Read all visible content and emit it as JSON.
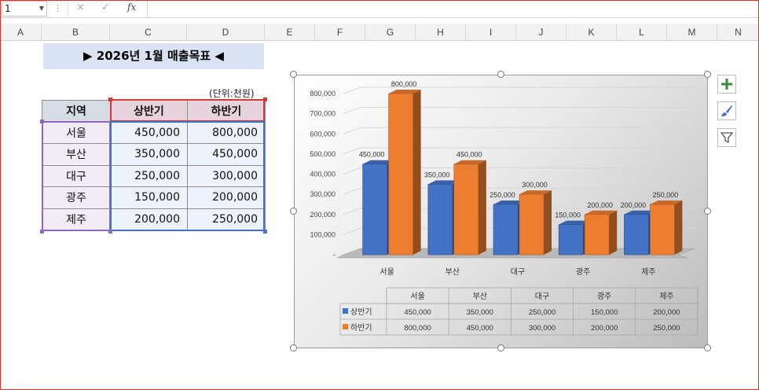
{
  "formula_bar": {
    "name_box": "1",
    "cancel_glyph": "×",
    "enter_glyph": "✓",
    "fx_label": "fx",
    "formula": ""
  },
  "columns": [
    "A",
    "B",
    "C",
    "D",
    "E",
    "F",
    "G",
    "H",
    "I",
    "J",
    "K",
    "L",
    "M",
    "N"
  ],
  "sheet": {
    "title": "▶ 2026년 1월 매출목표 ◀",
    "unit_note": "(단위:천원)",
    "headers": [
      "지역",
      "상반기",
      "하반기"
    ],
    "rows": [
      {
        "region": "서울",
        "h1": "450,000",
        "h2": "800,000"
      },
      {
        "region": "부산",
        "h1": "350,000",
        "h2": "450,000"
      },
      {
        "region": "대구",
        "h1": "250,000",
        "h2": "300,000"
      },
      {
        "region": "광주",
        "h1": "150,000",
        "h2": "200,000"
      },
      {
        "region": "제주",
        "h1": "200,000",
        "h2": "250,000"
      }
    ]
  },
  "chart_data": {
    "type": "bar",
    "style": "3d-clustered-column",
    "categories": [
      "서울",
      "부산",
      "대구",
      "광주",
      "제주"
    ],
    "series": [
      {
        "name": "상반기",
        "color": "#4472c4",
        "values": [
          450000,
          350000,
          250000,
          150000,
          200000
        ]
      },
      {
        "name": "하반기",
        "color": "#ed7d31",
        "values": [
          800000,
          450000,
          300000,
          200000,
          250000
        ]
      }
    ],
    "ylim": [
      0,
      800000
    ],
    "y_ticks": [
      "-",
      "100,000",
      "200,000",
      "300,000",
      "400,000",
      "500,000",
      "600,000",
      "700,000",
      "800,000"
    ],
    "data_labels": [
      [
        "450,000",
        "350,000",
        "250,000",
        "150,000",
        "200,000"
      ],
      [
        "800,000",
        "450,000",
        "300,000",
        "200,000",
        "250,000"
      ]
    ],
    "data_table": true,
    "legend": "data-table"
  },
  "chart_tools": {
    "add_element": "chart-elements-plus-icon",
    "styles": "chart-styles-brush-icon",
    "filter": "chart-filter-funnel-icon"
  }
}
